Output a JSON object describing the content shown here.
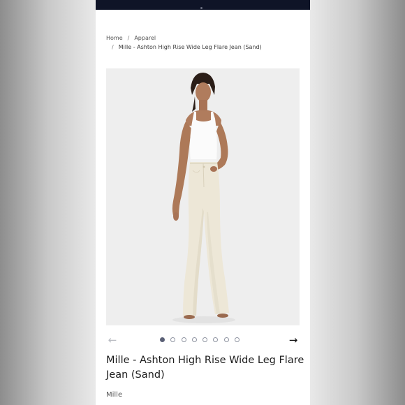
{
  "breadcrumb": {
    "home": "Home",
    "category": "Apparel",
    "separator": "/",
    "current": "Mille - Ashton High Rise Wide Leg Flare Jean (Sand)"
  },
  "gallery": {
    "prev_icon": "arrow-left-icon",
    "next_icon": "arrow-right-icon",
    "prev_glyph": "←",
    "next_glyph": "→",
    "slide_count": 8,
    "active_slide": 1
  },
  "product": {
    "title": "Mille - Ashton High Rise Wide Leg Flare Jean (Sand)",
    "brand": "Mille"
  },
  "colors": {
    "topbar": "#0f1427",
    "active_dot": "#5b6076"
  }
}
